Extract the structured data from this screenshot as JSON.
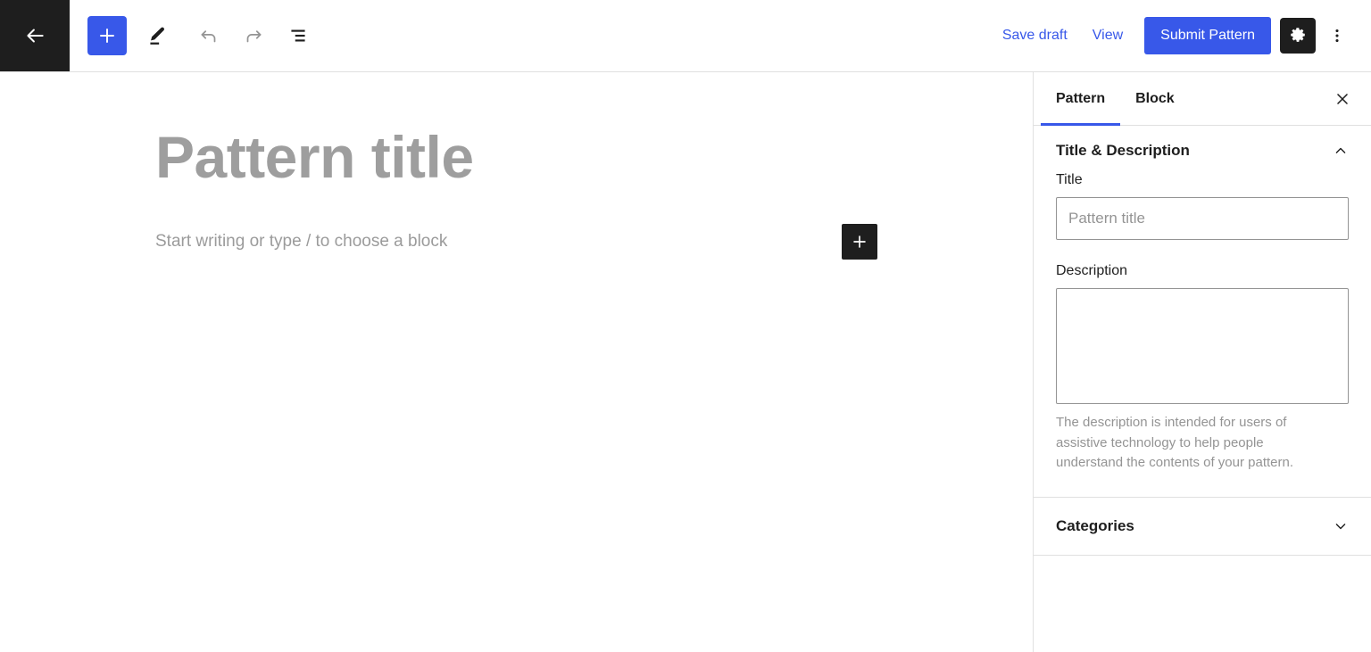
{
  "theme": {
    "accent_blue": "#3858e9",
    "dark": "#1e1e1e",
    "border_gray": "#e0e0e0",
    "input_border": "#949494",
    "muted_text": "#949494",
    "placeholder_title": "#9e9e9e"
  },
  "header": {
    "back_icon": "arrow-left-icon",
    "tools": [
      {
        "icon": "plus-icon",
        "name": "add-block-button",
        "label": "Add block"
      },
      {
        "icon": "pencil-icon",
        "name": "edit-tool-button",
        "label": "Edit"
      },
      {
        "icon": "undo-icon",
        "name": "undo-button",
        "label": "Undo"
      },
      {
        "icon": "redo-icon",
        "name": "redo-button",
        "label": "Redo"
      },
      {
        "icon": "list-view-icon",
        "name": "list-view-button",
        "label": "Document Overview"
      }
    ],
    "save_draft_label": "Save draft",
    "view_label": "View",
    "submit_label": "Submit Pattern",
    "settings_icon": "gear-icon",
    "more_icon": "kebab-menu-icon"
  },
  "canvas": {
    "pattern_title_placeholder": "Pattern title",
    "block_placeholder": "Start writing or type / to choose a block",
    "inserter_icon": "plus-icon"
  },
  "sidebar": {
    "tabs": [
      {
        "label": "Pattern",
        "active": true
      },
      {
        "label": "Block",
        "active": false
      }
    ],
    "close_icon": "close-icon",
    "panels": [
      {
        "title": "Title & Description",
        "expanded": true,
        "chevron": "chevron-up-icon",
        "fields": {
          "title_label": "Title",
          "title_value": "",
          "title_placeholder": "Pattern title",
          "description_label": "Description",
          "description_value": "",
          "description_placeholder": "",
          "description_help": "The description is intended for users of assistive technology to help people understand the contents of your pattern."
        }
      },
      {
        "title": "Categories",
        "expanded": false,
        "chevron": "chevron-down-icon"
      }
    ]
  }
}
